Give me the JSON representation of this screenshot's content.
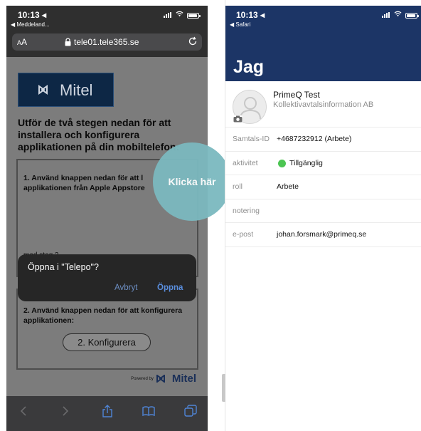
{
  "left": {
    "status": {
      "time": "10:13 ◂",
      "back_label": "◀ Meddeland..."
    },
    "urlbar": {
      "aa": "AA",
      "host": "tele01.tele365.se"
    },
    "page": {
      "logo_text": "Mitel",
      "heading": "Utför de två stegen nedan för att installera och konfigurera applikationen på din mobiltelefon:",
      "step1_line1": "1. Använd knappen nedan för att l",
      "step1_line2": "applikationen från Apple Appstore",
      "step1_tail": "med steg 2.",
      "step2_text": "2. Använd knappen nedan för att konfigurera applikationen:",
      "step2_button": "2. Konfigurera",
      "powered_by": "Powered by",
      "footer_logo": "Mitel"
    },
    "dialog": {
      "question": "Öppna i \"Telepo\"?",
      "cancel": "Avbryt",
      "open": "Öppna"
    }
  },
  "callout": {
    "label": "Klicka här",
    "color": "#7bb9bf"
  },
  "right": {
    "status": {
      "time": "10:13 ◂",
      "back_label": "◀ Safari"
    },
    "title": "Jag",
    "profile": {
      "name": "PrimeQ Test",
      "org": "Kollektivavtalsinformation AB"
    },
    "fields": [
      {
        "label": "Samtals-ID",
        "value": "+4687232912 (Arbete)"
      },
      {
        "label": "aktivitet",
        "value": "Tillgänglig",
        "status_color": "#4cc552"
      },
      {
        "label": "roll",
        "value": "Arbete"
      },
      {
        "label": "notering",
        "value": ""
      },
      {
        "label": "e-post",
        "value": "johan.forsmark@primeq.se"
      }
    ],
    "header_color": "#1c3566"
  }
}
